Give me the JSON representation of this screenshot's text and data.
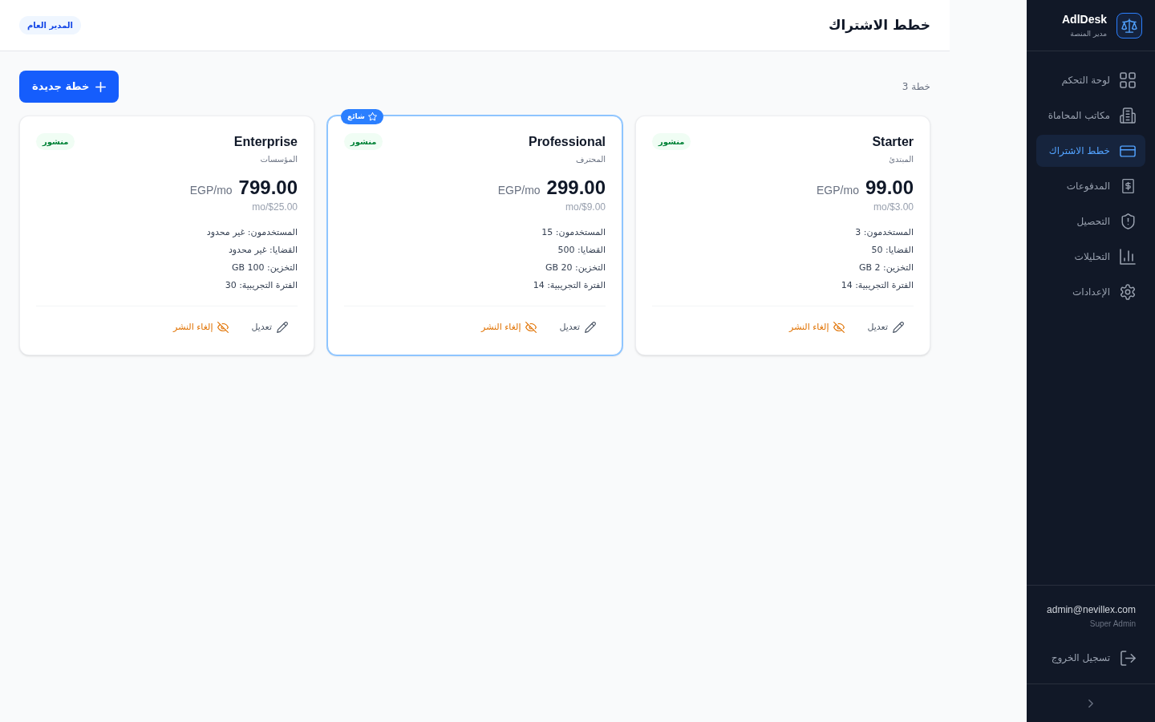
{
  "sidebar": {
    "brand": "AdlDesk",
    "subtitle": "مدير المنصة",
    "items": [
      {
        "label": "لوحة التحكم",
        "selected": false
      },
      {
        "label": "مكاتب المحاماة",
        "selected": false
      },
      {
        "label": "خطط الاشتراك",
        "selected": true
      },
      {
        "label": "المدفوعات",
        "selected": false
      },
      {
        "label": "التحصيل",
        "selected": false
      },
      {
        "label": "التحليلات",
        "selected": false
      },
      {
        "label": "الإعدادات",
        "selected": false
      }
    ],
    "user": {
      "email": "admin@nevillex.com",
      "role": "Super Admin"
    },
    "logout": "تسجيل الخروج"
  },
  "header": {
    "title": "خطط الاشتراك",
    "role_badge": "المدير العام"
  },
  "toolbar": {
    "count": "خطة 3",
    "new_button": "خطة جديدة"
  },
  "plans": [
    {
      "name": "Starter",
      "subtitle": "المبتدئ",
      "status": "منشور",
      "popular": false,
      "price": "99.00",
      "unit": "EGP/mo",
      "usd_price": "$3.00/mo",
      "features": [
        "المستخدمون: 3",
        "القضايا: 50",
        "التخزين: 2 GB",
        "الفترة التجريبية: 14"
      ],
      "edit": "تعديل",
      "unpublish": "إلغاء النشر"
    },
    {
      "name": "Professional",
      "subtitle": "المحترف",
      "status": "منشور",
      "popular": true,
      "popular_label": "شائع",
      "price": "299.00",
      "unit": "EGP/mo",
      "usd_price": "$9.00/mo",
      "features": [
        "المستخدمون: 15",
        "القضايا: 500",
        "التخزين: 20 GB",
        "الفترة التجريبية: 14"
      ],
      "edit": "تعديل",
      "unpublish": "إلغاء النشر"
    },
    {
      "name": "Enterprise",
      "subtitle": "المؤسسات",
      "status": "منشور",
      "popular": false,
      "price": "799.00",
      "unit": "EGP/mo",
      "usd_price": "$25.00/mo",
      "features": [
        "المستخدمون: غير محدود",
        "القضايا: غير محدود",
        "التخزين: 100 GB",
        "الفترة التجريبية: 30"
      ],
      "edit": "تعديل",
      "unpublish": "إلغاء النشر"
    }
  ]
}
